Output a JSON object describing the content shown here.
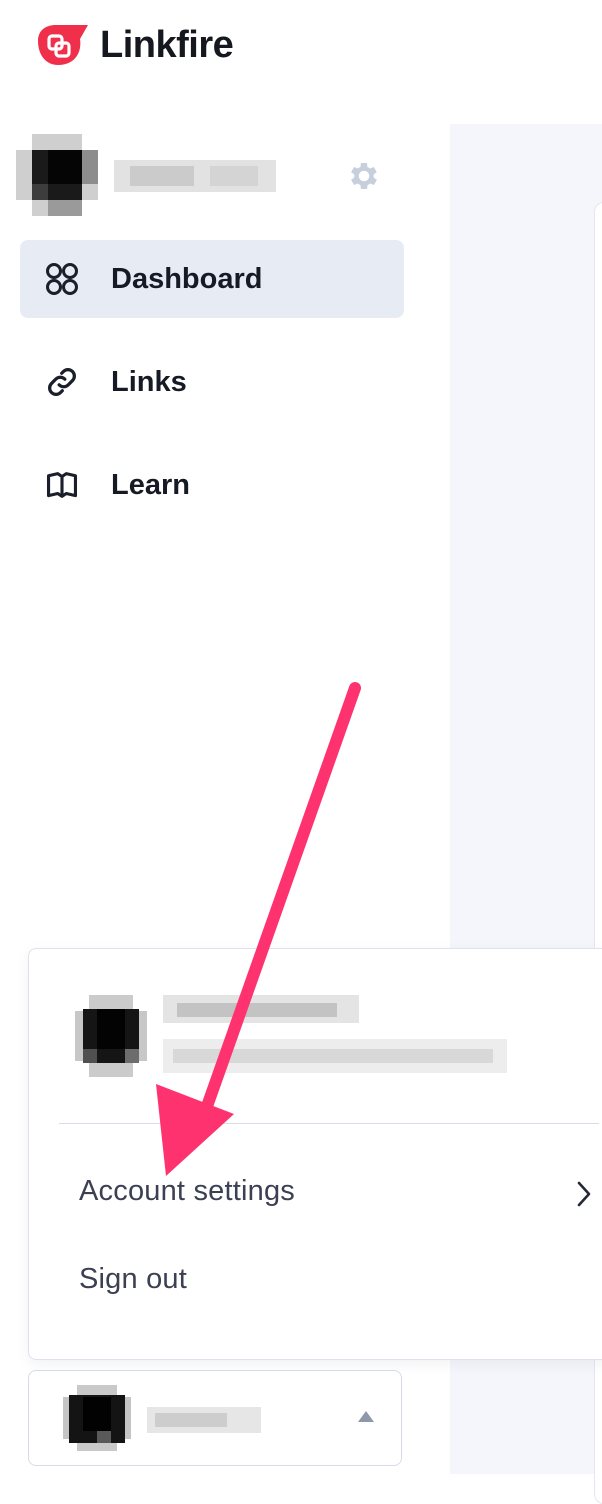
{
  "brand": {
    "name": "Linkfire",
    "color": "#f0304b"
  },
  "sidebar": {
    "org": {
      "avatar": "pixelated-avatar",
      "name": "",
      "settings_icon": "gear-icon"
    },
    "nav": [
      {
        "label": "Dashboard",
        "icon": "grid-icon",
        "active": true
      },
      {
        "label": "Links",
        "icon": "link-icon",
        "active": false
      },
      {
        "label": "Learn",
        "icon": "book-icon",
        "active": false
      }
    ]
  },
  "user_menu": {
    "user_name": "",
    "user_email": "",
    "items": [
      {
        "label": "Account settings",
        "icon": "chevron-right-icon"
      },
      {
        "label": "Sign out"
      }
    ]
  },
  "account_switcher": {
    "name": "",
    "icon": "caret-up-icon"
  },
  "annotation": {
    "type": "arrow",
    "color": "#ff3270",
    "target": "Account settings"
  }
}
